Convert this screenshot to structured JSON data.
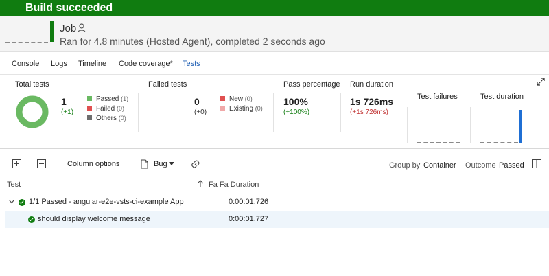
{
  "banner": {
    "title": "Build succeeded"
  },
  "job": {
    "title": "Job",
    "subtitle": "Ran for 4.8 minutes (Hosted Agent), completed 2 seconds ago"
  },
  "tabs": [
    {
      "label": "Console"
    },
    {
      "label": "Logs"
    },
    {
      "label": "Timeline"
    },
    {
      "label": "Code coverage*"
    },
    {
      "label": "Tests"
    }
  ],
  "summary": {
    "total": {
      "label": "Total tests",
      "count": "1",
      "delta": "(+1)",
      "passed_label": "Passed",
      "passed_count": "(1)",
      "failed_label": "Failed",
      "failed_count": "(0)",
      "others_label": "Others",
      "others_count": "(0)",
      "pass_fraction": 1.0
    },
    "failed": {
      "label": "Failed tests",
      "count": "0",
      "delta": "(+0)",
      "new_label": "New",
      "new_count": "(0)",
      "existing_label": "Existing",
      "existing_count": "(0)"
    },
    "pass_percentage": {
      "label": "Pass percentage",
      "value": "100%",
      "delta": "(+100%)"
    },
    "run_duration": {
      "label": "Run duration",
      "value": "1s 726ms",
      "delta": "(+1s 726ms)"
    },
    "test_failures": {
      "label": "Test failures"
    },
    "test_duration": {
      "label": "Test duration"
    }
  },
  "colors": {
    "success": "#107c10",
    "passed": "#6ab962",
    "failed": "#e05050",
    "others": "#6e6e6e",
    "existing": "#f0a8a8",
    "accent": "#1f5fb4",
    "duration_bar": "#1f6fd4"
  },
  "toolbar": {
    "expand_all_icon": "plus-square-icon",
    "collapse_all_icon": "minus-square-icon",
    "column_options": "Column options",
    "bug": "Bug",
    "group_by_label": "Group by",
    "group_by_value": "Container",
    "outcome_label": "Outcome",
    "outcome_value": "Passed"
  },
  "grid": {
    "col_test": "Test",
    "col_duration": "Fa Fa Duration",
    "rows": [
      {
        "name": "1/1 Passed - angular-e2e-vsts-ci-example App",
        "duration": "0:00:01.726"
      },
      {
        "name": "should display welcome message",
        "duration": "0:00:01.727"
      }
    ]
  }
}
